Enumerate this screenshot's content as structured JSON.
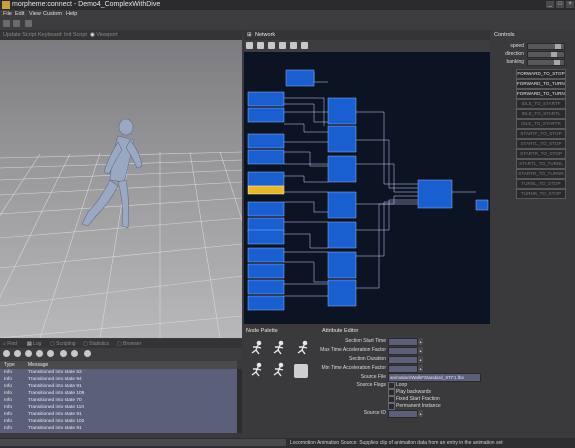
{
  "app": {
    "title": "morpheme:connect - Demo4_ComplexWithDive",
    "icon": "app-icon",
    "window_buttons": [
      "_",
      "□",
      "×"
    ]
  },
  "menu": [
    "File",
    "Edit",
    "View",
    "Custom",
    "Help"
  ],
  "viewport_tabs": [
    {
      "label": "Update Script",
      "active": false
    },
    {
      "label": "Keyboard",
      "active": false
    },
    {
      "label": "Init Script",
      "active": false
    },
    {
      "label": "Viewport",
      "active": true
    }
  ],
  "network": {
    "title": "Network"
  },
  "controls": {
    "title": "Controls",
    "params": [
      {
        "label": "speed",
        "value": 0.9
      },
      {
        "label": "direction",
        "value": 0.75
      },
      {
        "label": "banking",
        "value": 0.85
      }
    ],
    "requests": [
      {
        "label": "FORWARD_TO_STOP",
        "enabled": true
      },
      {
        "label": "FORWARD_TO_TURNL",
        "enabled": true
      },
      {
        "label": "FORWARD_TO_TURNR",
        "enabled": true
      },
      {
        "label": "IDLE_TO_STARTF",
        "enabled": false
      },
      {
        "label": "IDLE_TO_STARTL",
        "enabled": false
      },
      {
        "label": "IDLE_TO_STARTR",
        "enabled": false
      },
      {
        "label": "STARTF_TO_STOP",
        "enabled": false
      },
      {
        "label": "STARTL_TO_STOP",
        "enabled": false
      },
      {
        "label": "STARTR_TO_STOP",
        "enabled": false
      },
      {
        "label": "STARTL_TO_TURNL",
        "enabled": false
      },
      {
        "label": "STARTR_TO_TURNR",
        "enabled": false
      },
      {
        "label": "TURNL_TO_STOP",
        "enabled": false
      },
      {
        "label": "TURNR_TO_STOP",
        "enabled": false
      }
    ]
  },
  "log": {
    "tabs": [
      {
        "label": "Find",
        "active": false
      },
      {
        "label": "Log",
        "active": true
      },
      {
        "label": "Scripting",
        "active": false
      },
      {
        "label": "Statistics",
        "active": false
      },
      {
        "label": "Browser",
        "active": false
      }
    ],
    "columns": [
      "Type",
      "Message"
    ],
    "rows": [
      {
        "type": "Info",
        "message": "Transitioned into state 53"
      },
      {
        "type": "Info",
        "message": "Transitioned into state 94"
      },
      {
        "type": "Info",
        "message": "Transitioned into state 91"
      },
      {
        "type": "Info",
        "message": "Transitioned into state 109"
      },
      {
        "type": "Info",
        "message": "Transitioned into state 70"
      },
      {
        "type": "Info",
        "message": "Transitioned into state 110"
      },
      {
        "type": "Info",
        "message": "Transitioned into state 91"
      },
      {
        "type": "Info",
        "message": "Transitioned into state 102"
      },
      {
        "type": "Info",
        "message": "Transitioned into state 91"
      }
    ]
  },
  "palette": {
    "title": "Node Palette"
  },
  "attributes": {
    "title": "Attribute Editor",
    "fields": [
      {
        "label": "Section Start Time",
        "value": ""
      },
      {
        "label": "Max Time Acceleration Factor",
        "value": ""
      },
      {
        "label": "Section Duration",
        "value": ""
      },
      {
        "label": "Min Time Acceleration Factor",
        "value": ""
      }
    ],
    "source_file_label": "Source File",
    "source_file_value": "animation\\WalkFStandard_STF1.fbx",
    "source_flags_label": "Source Flags",
    "flags": [
      {
        "label": "Loop",
        "checked": false
      },
      {
        "label": "Play backwards",
        "checked": false
      },
      {
        "label": "Fixed Start Fraction",
        "checked": false
      },
      {
        "label": "Permanent Instance",
        "checked": false
      }
    ],
    "source_id_label": "Source ID"
  },
  "status": {
    "message": "Locomotion Animation Source: Supplies clip of animation data from an entry in the animation set"
  }
}
